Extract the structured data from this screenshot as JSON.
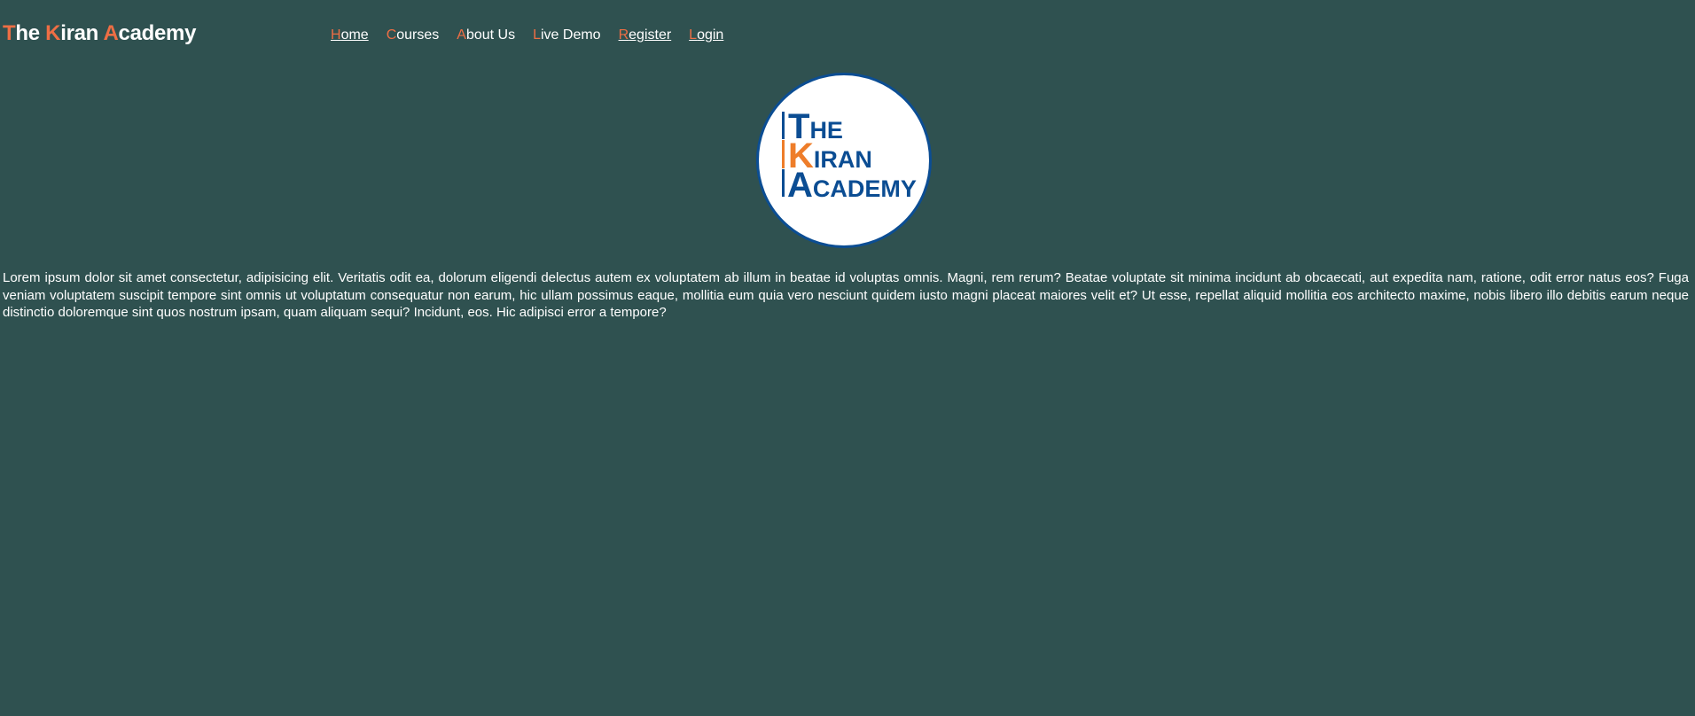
{
  "brand": {
    "parts": [
      {
        "initial": "T",
        "rest": "he "
      },
      {
        "initial": "K",
        "rest": "iran "
      },
      {
        "initial": "A",
        "rest": "cademy"
      }
    ]
  },
  "nav": {
    "items": [
      {
        "initial": "H",
        "rest": "ome",
        "underlined": true
      },
      {
        "initial": "C",
        "rest": "ourses",
        "underlined": false
      },
      {
        "initial": "A",
        "rest": "bout Us",
        "underlined": false
      },
      {
        "initial": "L",
        "rest": "ive Demo",
        "underlined": false
      },
      {
        "initial": "R",
        "rest": "egister",
        "underlined": true
      },
      {
        "initial": "L",
        "rest": "ogin",
        "underlined": true
      }
    ]
  },
  "logo": {
    "line1_initial": "T",
    "line1_rest": "HE",
    "line2_initial": "K",
    "line2_rest": "IRAN",
    "line3_initial": "A",
    "line3_rest": "CADEMY"
  },
  "main": {
    "paragraph": "Lorem ipsum dolor sit amet consectetur, adipisicing elit. Veritatis odit ea, dolorum eligendi delectus autem ex voluptatem ab illum in beatae id voluptas omnis. Magni, rem rerum? Beatae voluptate sit minima incidunt ab obcaecati, aut expedita nam, ratione, odit error natus eos? Fuga veniam voluptatem suscipit tempore sint omnis ut voluptatum consequatur non earum, hic ullam possimus eaque, mollitia eum quia vero nesciunt quidem iusto magni placeat maiores velit et? Ut esse, repellat aliquid mollitia eos architecto maxime, nobis libero illo debitis earum neque distinctio doloremque sint quos nostrum ipsam, quam aliquam sequi? Incidunt, eos. Hic adipisci error a tempore?"
  },
  "colors": {
    "background": "#2f5150",
    "accent": "#ee6e44",
    "logo_blue": "#0b4d93",
    "logo_orange": "#ee7d2a"
  }
}
